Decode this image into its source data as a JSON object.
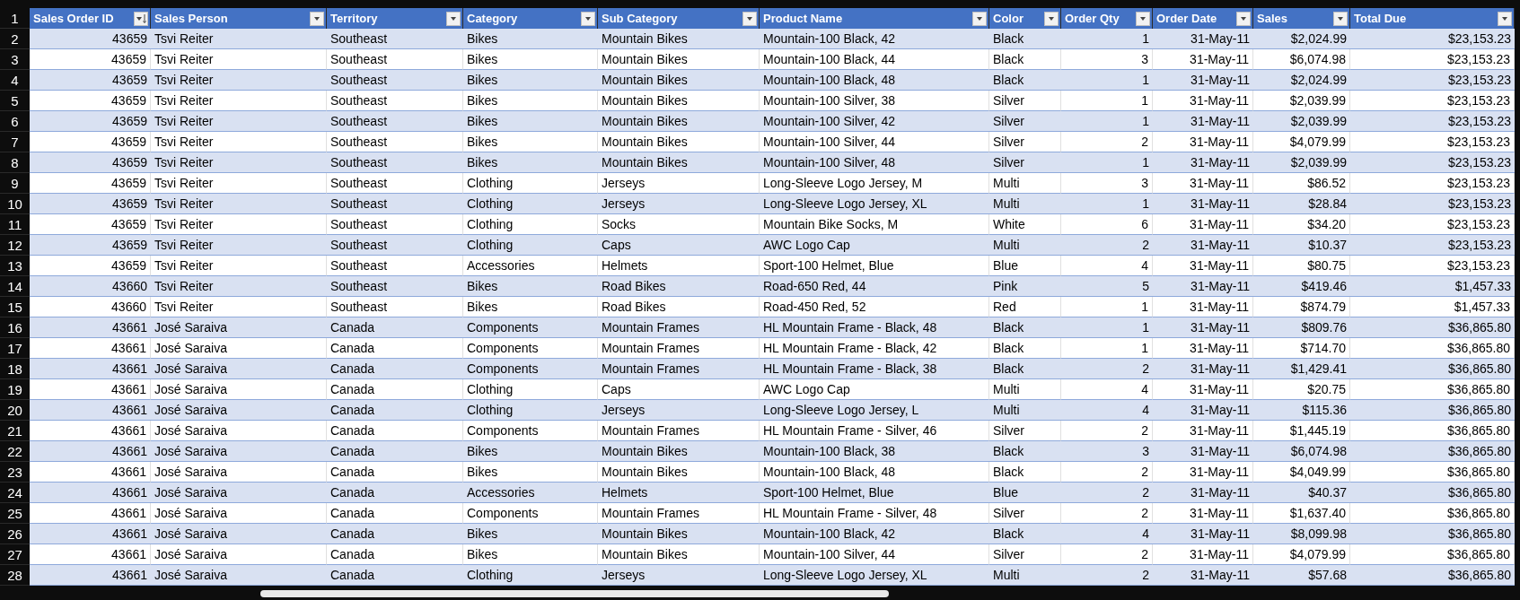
{
  "sheet": {
    "header_row_number": "1",
    "columns": [
      {
        "label": "Sales Order ID",
        "kind": "number",
        "sorted": true
      },
      {
        "label": "Sales Person",
        "kind": "text",
        "sorted": false
      },
      {
        "label": "Territory",
        "kind": "text",
        "sorted": false
      },
      {
        "label": "Category",
        "kind": "text",
        "sorted": false
      },
      {
        "label": "Sub Category",
        "kind": "text",
        "sorted": false
      },
      {
        "label": "Product Name",
        "kind": "text",
        "sorted": false
      },
      {
        "label": "Color",
        "kind": "text",
        "sorted": false
      },
      {
        "label": "Order Qty",
        "kind": "number",
        "sorted": false
      },
      {
        "label": "Order Date",
        "kind": "number",
        "sorted": false
      },
      {
        "label": "Sales",
        "kind": "number",
        "sorted": false
      },
      {
        "label": "Total Due",
        "kind": "number",
        "sorted": false
      }
    ],
    "rows": [
      {
        "number": "2",
        "cells": [
          "43659",
          "Tsvi Reiter",
          "Southeast",
          "Bikes",
          "Mountain Bikes",
          "Mountain-100 Black, 42",
          "Black",
          "1",
          "31-May-11",
          "$2,024.99",
          "$23,153.23"
        ]
      },
      {
        "number": "3",
        "cells": [
          "43659",
          "Tsvi Reiter",
          "Southeast",
          "Bikes",
          "Mountain Bikes",
          "Mountain-100 Black, 44",
          "Black",
          "3",
          "31-May-11",
          "$6,074.98",
          "$23,153.23"
        ]
      },
      {
        "number": "4",
        "cells": [
          "43659",
          "Tsvi Reiter",
          "Southeast",
          "Bikes",
          "Mountain Bikes",
          "Mountain-100 Black, 48",
          "Black",
          "1",
          "31-May-11",
          "$2,024.99",
          "$23,153.23"
        ]
      },
      {
        "number": "5",
        "cells": [
          "43659",
          "Tsvi Reiter",
          "Southeast",
          "Bikes",
          "Mountain Bikes",
          "Mountain-100 Silver, 38",
          "Silver",
          "1",
          "31-May-11",
          "$2,039.99",
          "$23,153.23"
        ]
      },
      {
        "number": "6",
        "cells": [
          "43659",
          "Tsvi Reiter",
          "Southeast",
          "Bikes",
          "Mountain Bikes",
          "Mountain-100 Silver, 42",
          "Silver",
          "1",
          "31-May-11",
          "$2,039.99",
          "$23,153.23"
        ]
      },
      {
        "number": "7",
        "cells": [
          "43659",
          "Tsvi Reiter",
          "Southeast",
          "Bikes",
          "Mountain Bikes",
          "Mountain-100 Silver, 44",
          "Silver",
          "2",
          "31-May-11",
          "$4,079.99",
          "$23,153.23"
        ]
      },
      {
        "number": "8",
        "cells": [
          "43659",
          "Tsvi Reiter",
          "Southeast",
          "Bikes",
          "Mountain Bikes",
          "Mountain-100 Silver, 48",
          "Silver",
          "1",
          "31-May-11",
          "$2,039.99",
          "$23,153.23"
        ]
      },
      {
        "number": "9",
        "cells": [
          "43659",
          "Tsvi Reiter",
          "Southeast",
          "Clothing",
          "Jerseys",
          "Long-Sleeve Logo Jersey, M",
          "Multi",
          "3",
          "31-May-11",
          "$86.52",
          "$23,153.23"
        ]
      },
      {
        "number": "10",
        "cells": [
          "43659",
          "Tsvi Reiter",
          "Southeast",
          "Clothing",
          "Jerseys",
          "Long-Sleeve Logo Jersey, XL",
          "Multi",
          "1",
          "31-May-11",
          "$28.84",
          "$23,153.23"
        ]
      },
      {
        "number": "11",
        "cells": [
          "43659",
          "Tsvi Reiter",
          "Southeast",
          "Clothing",
          "Socks",
          "Mountain Bike Socks, M",
          "White",
          "6",
          "31-May-11",
          "$34.20",
          "$23,153.23"
        ]
      },
      {
        "number": "12",
        "cells": [
          "43659",
          "Tsvi Reiter",
          "Southeast",
          "Clothing",
          "Caps",
          "AWC Logo Cap",
          "Multi",
          "2",
          "31-May-11",
          "$10.37",
          "$23,153.23"
        ]
      },
      {
        "number": "13",
        "cells": [
          "43659",
          "Tsvi Reiter",
          "Southeast",
          "Accessories",
          "Helmets",
          "Sport-100 Helmet, Blue",
          "Blue",
          "4",
          "31-May-11",
          "$80.75",
          "$23,153.23"
        ]
      },
      {
        "number": "14",
        "cells": [
          "43660",
          "Tsvi Reiter",
          "Southeast",
          "Bikes",
          "Road Bikes",
          "Road-650 Red, 44",
          "Pink",
          "5",
          "31-May-11",
          "$419.46",
          "$1,457.33"
        ]
      },
      {
        "number": "15",
        "cells": [
          "43660",
          "Tsvi Reiter",
          "Southeast",
          "Bikes",
          "Road Bikes",
          "Road-450 Red, 52",
          "Red",
          "1",
          "31-May-11",
          "$874.79",
          "$1,457.33"
        ]
      },
      {
        "number": "16",
        "cells": [
          "43661",
          "José Saraiva",
          "Canada",
          "Components",
          "Mountain Frames",
          "HL Mountain Frame - Black, 48",
          "Black",
          "1",
          "31-May-11",
          "$809.76",
          "$36,865.80"
        ]
      },
      {
        "number": "17",
        "cells": [
          "43661",
          "José Saraiva",
          "Canada",
          "Components",
          "Mountain Frames",
          "HL Mountain Frame - Black, 42",
          "Black",
          "1",
          "31-May-11",
          "$714.70",
          "$36,865.80"
        ]
      },
      {
        "number": "18",
        "cells": [
          "43661",
          "José Saraiva",
          "Canada",
          "Components",
          "Mountain Frames",
          "HL Mountain Frame - Black, 38",
          "Black",
          "2",
          "31-May-11",
          "$1,429.41",
          "$36,865.80"
        ]
      },
      {
        "number": "19",
        "cells": [
          "43661",
          "José Saraiva",
          "Canada",
          "Clothing",
          "Caps",
          "AWC Logo Cap",
          "Multi",
          "4",
          "31-May-11",
          "$20.75",
          "$36,865.80"
        ]
      },
      {
        "number": "20",
        "cells": [
          "43661",
          "José Saraiva",
          "Canada",
          "Clothing",
          "Jerseys",
          "Long-Sleeve Logo Jersey, L",
          "Multi",
          "4",
          "31-May-11",
          "$115.36",
          "$36,865.80"
        ]
      },
      {
        "number": "21",
        "cells": [
          "43661",
          "José Saraiva",
          "Canada",
          "Components",
          "Mountain Frames",
          "HL Mountain Frame - Silver, 46",
          "Silver",
          "2",
          "31-May-11",
          "$1,445.19",
          "$36,865.80"
        ]
      },
      {
        "number": "22",
        "cells": [
          "43661",
          "José Saraiva",
          "Canada",
          "Bikes",
          "Mountain Bikes",
          "Mountain-100 Black, 38",
          "Black",
          "3",
          "31-May-11",
          "$6,074.98",
          "$36,865.80"
        ]
      },
      {
        "number": "23",
        "cells": [
          "43661",
          "José Saraiva",
          "Canada",
          "Bikes",
          "Mountain Bikes",
          "Mountain-100 Black, 48",
          "Black",
          "2",
          "31-May-11",
          "$4,049.99",
          "$36,865.80"
        ]
      },
      {
        "number": "24",
        "cells": [
          "43661",
          "José Saraiva",
          "Canada",
          "Accessories",
          "Helmets",
          "Sport-100 Helmet, Blue",
          "Blue",
          "2",
          "31-May-11",
          "$40.37",
          "$36,865.80"
        ]
      },
      {
        "number": "25",
        "cells": [
          "43661",
          "José Saraiva",
          "Canada",
          "Components",
          "Mountain Frames",
          "HL Mountain Frame - Silver, 48",
          "Silver",
          "2",
          "31-May-11",
          "$1,637.40",
          "$36,865.80"
        ]
      },
      {
        "number": "26",
        "cells": [
          "43661",
          "José Saraiva",
          "Canada",
          "Bikes",
          "Mountain Bikes",
          "Mountain-100 Black, 42",
          "Black",
          "4",
          "31-May-11",
          "$8,099.98",
          "$36,865.80"
        ]
      },
      {
        "number": "27",
        "cells": [
          "43661",
          "José Saraiva",
          "Canada",
          "Bikes",
          "Mountain Bikes",
          "Mountain-100 Silver, 44",
          "Silver",
          "2",
          "31-May-11",
          "$4,079.99",
          "$36,865.80"
        ]
      },
      {
        "number": "28",
        "cells": [
          "43661",
          "José Saraiva",
          "Canada",
          "Clothing",
          "Jerseys",
          "Long-Sleeve Logo Jersey, XL",
          "Multi",
          "2",
          "31-May-11",
          "$57.68",
          "$36,865.80"
        ]
      }
    ]
  }
}
